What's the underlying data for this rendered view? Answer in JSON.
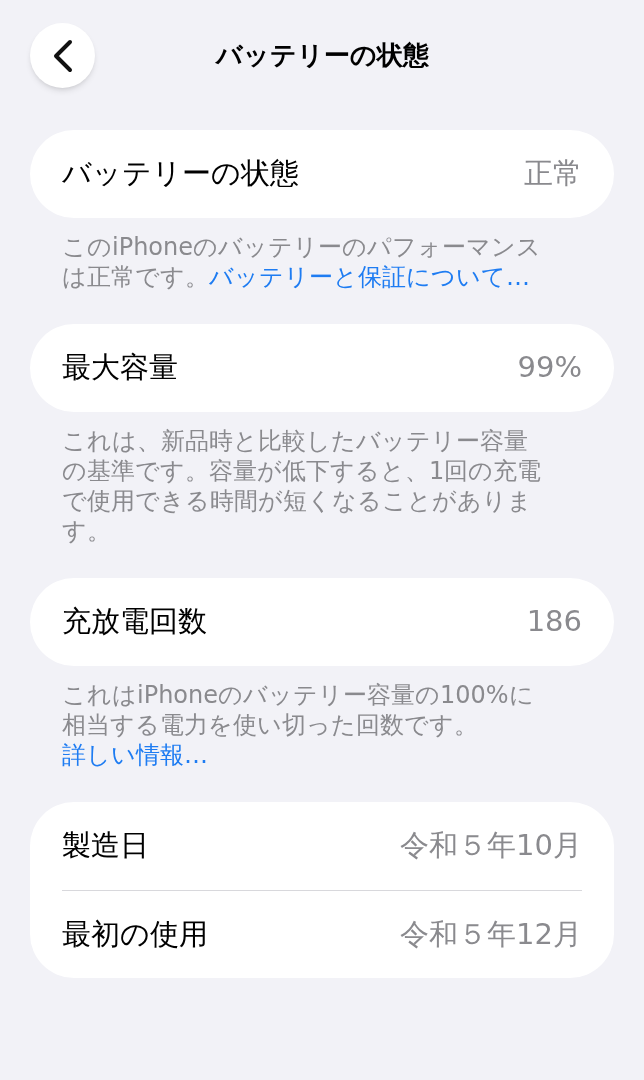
{
  "nav": {
    "title": "バッテリーの状態"
  },
  "sections": [
    {
      "rows": [
        {
          "label": "バッテリーの状態",
          "value": "正常"
        }
      ],
      "footer": {
        "text": "このiPhoneのバッテリーのパフォーマンスは正常です。",
        "link": "バッテリーと保証について…"
      }
    },
    {
      "rows": [
        {
          "label": "最大容量",
          "value": "99%"
        }
      ],
      "footer": {
        "text": "これは、新品時と比較したバッテリー容量の基準です。容量が低下すると、1回の充電で使用できる時間が短くなることがあります。"
      }
    },
    {
      "rows": [
        {
          "label": "充放電回数",
          "value": "186"
        }
      ],
      "footer": {
        "text": "これはiPhoneのバッテリー容量の100%に相当する電力を使い切った回数です。",
        "link_line": "詳しい情報…"
      }
    },
    {
      "rows": [
        {
          "label": "製造日",
          "value": "令和５年10月"
        },
        {
          "label": "最初の使用",
          "value": "令和５年12月"
        }
      ]
    }
  ]
}
